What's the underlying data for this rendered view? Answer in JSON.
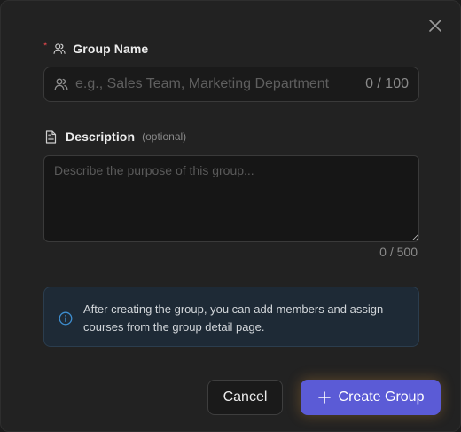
{
  "dialog": {
    "close_icon": "close-icon"
  },
  "group_name": {
    "required_marker": "*",
    "label": "Group Name",
    "label_icon": "users-icon",
    "input_icon": "users-icon",
    "placeholder": "e.g., Sales Team, Marketing Department",
    "value": "",
    "counter": "0 / 100"
  },
  "description": {
    "label": "Description",
    "label_icon": "file-text-icon",
    "optional_text": "(optional)",
    "placeholder": "Describe the purpose of this group...",
    "value": "",
    "counter": "0 / 500"
  },
  "info": {
    "icon": "info-icon",
    "line1": "After creating the group, you can add members and assign",
    "line2": "courses from the group detail page."
  },
  "actions": {
    "cancel_label": "Cancel",
    "create_label": "Create Group",
    "create_icon": "plus-icon"
  },
  "colors": {
    "background": "#222222",
    "accent": "#5b5bd6",
    "required": "#e5484d",
    "info_bg": "#1e2a36",
    "info_icon": "#3e8ed0"
  }
}
